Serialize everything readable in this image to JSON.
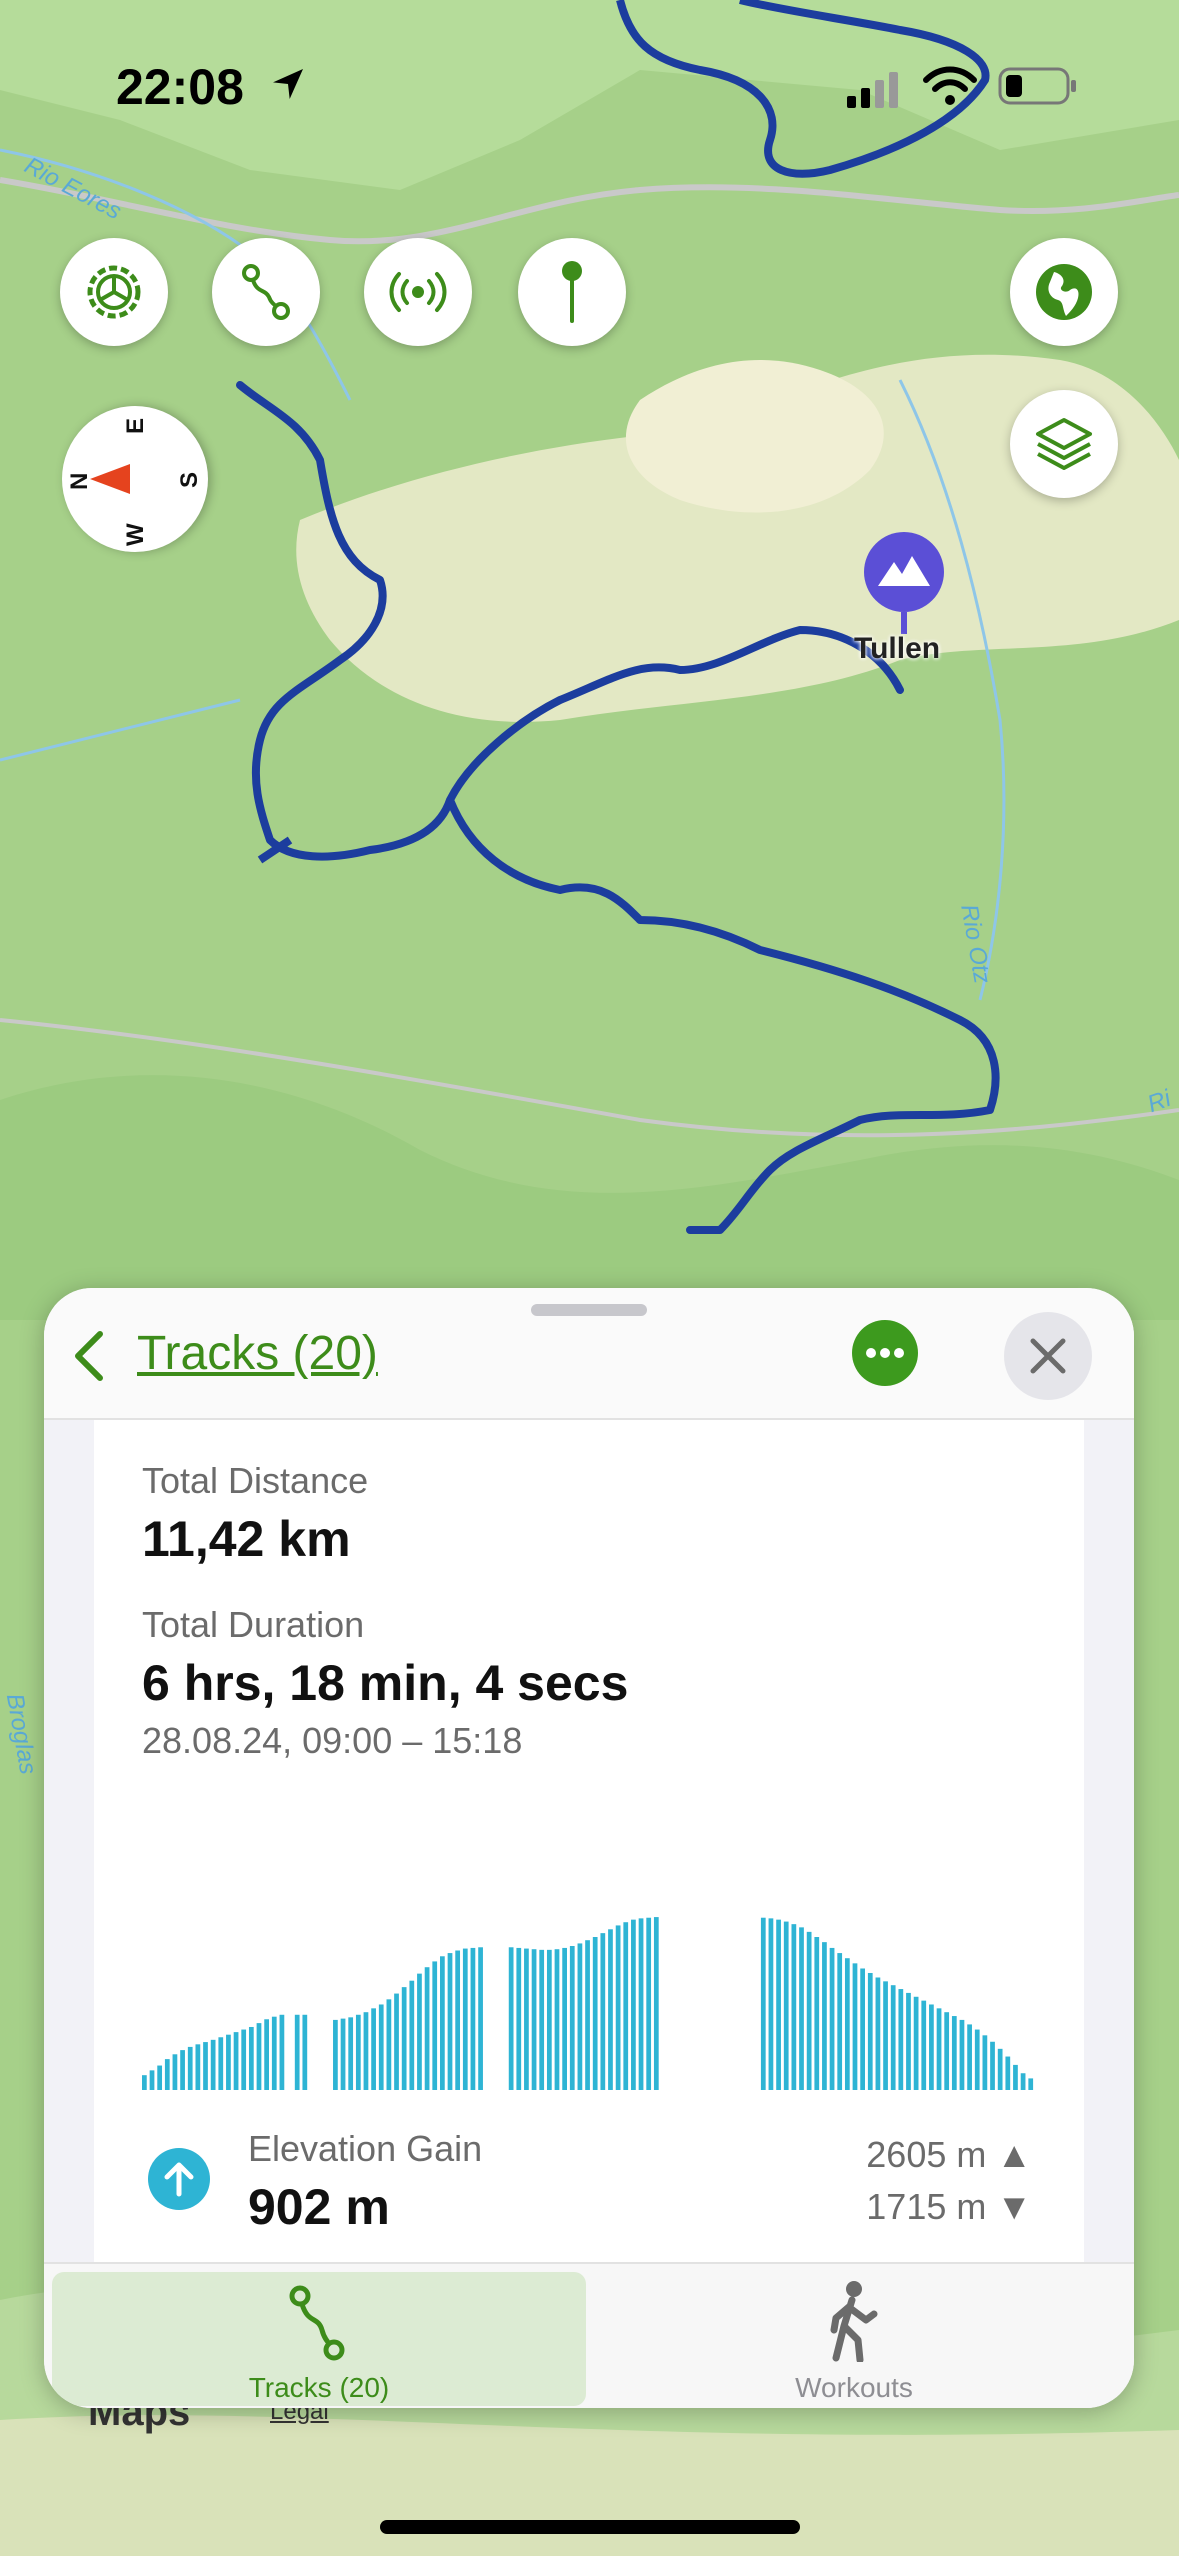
{
  "status_bar": {
    "time": "22:08"
  },
  "map": {
    "poi_label": "Tullen",
    "rivers": [
      "Rio Eores",
      "Rio Otz",
      "Ri",
      "Broglas"
    ],
    "attribution": {
      "logo": "Maps",
      "legal": "Legal"
    },
    "controls": [
      "settings-icon",
      "route-icon",
      "broadcast-icon",
      "pin-icon",
      "globe-icon",
      "layers-icon"
    ],
    "compass": {
      "north": "N",
      "south": "S",
      "east": "E",
      "west": "W"
    },
    "colors": {
      "track": "#1c3d9e",
      "poi": "#5b4fd6",
      "accent": "#3d8c1a"
    }
  },
  "sheet": {
    "title": "Tracks (20)",
    "total_distance_label": "Total Distance",
    "total_distance_value": "11,42 km",
    "total_duration_label": "Total Duration",
    "total_duration_value": "6 hrs, 18 min, 4 secs",
    "date_range": "28.08.24, 09:00 – 15:18",
    "elevation_gain_label": "Elevation Gain",
    "elevation_gain_value": "902 m",
    "max_elevation": "2605 m ▲",
    "min_elevation": "1715 m ▼"
  },
  "chart_data": {
    "type": "bar",
    "description_free": true,
    "color": "#2eb4d4",
    "ylim": [
      1715,
      2605
    ],
    "values": [
      1730,
      1745,
      1760,
      1780,
      1795,
      1808,
      1818,
      1826,
      1833,
      1840,
      1848,
      1856,
      1864,
      1872,
      1880,
      1892,
      1904,
      1912,
      1918,
      null,
      1918,
      1918,
      null,
      null,
      null,
      1902,
      1906,
      1910,
      1918,
      1926,
      1938,
      1950,
      1966,
      1984,
      2004,
      2024,
      2046,
      2066,
      2084,
      2100,
      2110,
      2118,
      2124,
      2126,
      2128,
      null,
      null,
      null,
      2128,
      2126,
      2124,
      2122,
      2120,
      2120,
      2122,
      2126,
      2132,
      2140,
      2150,
      2160,
      2172,
      2184,
      2196,
      2206,
      2214,
      2218,
      2220,
      2222,
      null,
      null,
      null,
      null,
      null,
      null,
      null,
      null,
      null,
      null,
      null,
      null,
      null,
      2220,
      2218,
      2214,
      2208,
      2200,
      2190,
      2176,
      2160,
      2144,
      2126,
      2110,
      2094,
      2078,
      2062,
      2048,
      2034,
      2022,
      2010,
      1998,
      1986,
      1974,
      1962,
      1950,
      1938,
      1926,
      1914,
      1902,
      1888,
      1872,
      1854,
      1834,
      1812,
      1788,
      1762,
      1736,
      1720
    ]
  },
  "tabs": [
    {
      "label": "Tracks (20)",
      "icon": "route-icon",
      "selected": true
    },
    {
      "label": "Workouts",
      "icon": "walking-person-icon",
      "selected": false
    }
  ]
}
